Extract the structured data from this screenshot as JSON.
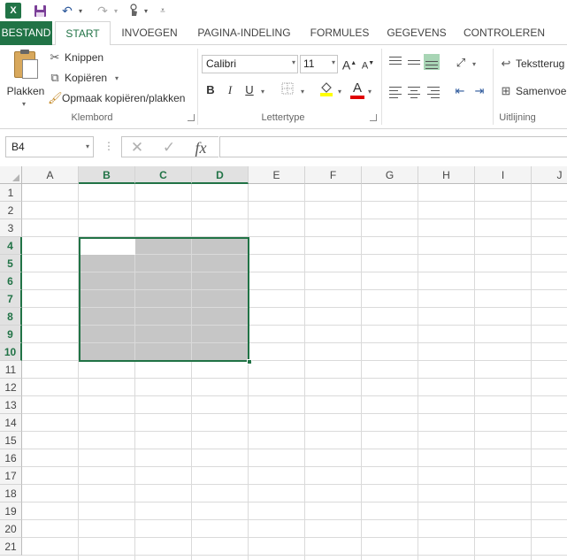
{
  "quick_access": {
    "app_icon": "excel-logo-icon",
    "app_icon_text": "X",
    "save_icon": "save-icon",
    "undo_icon": "undo-icon",
    "redo_icon": "redo-icon",
    "touch_icon": "touch-mode-icon",
    "customize_icon": "customize-toolbar-icon"
  },
  "tabs": [
    {
      "label": "BESTAND",
      "active": false
    },
    {
      "label": "START",
      "active": true
    },
    {
      "label": "INVOEGEN",
      "active": false
    },
    {
      "label": "PAGINA-INDELING",
      "active": false
    },
    {
      "label": "FORMULES",
      "active": false
    },
    {
      "label": "GEGEVENS",
      "active": false
    },
    {
      "label": "CONTROLEREN",
      "active": false
    }
  ],
  "ribbon": {
    "clipboard": {
      "paste_label": "Plakken",
      "cut_label": "Knippen",
      "copy_label": "Kopiëren",
      "format_painter_label": "Opmaak kopiëren/plakken",
      "group_label": "Klembord"
    },
    "font": {
      "font_name": "Calibri",
      "font_size": "11",
      "bold": "B",
      "italic": "I",
      "underline": "U",
      "font_color_letter": "A",
      "grow_font": "A",
      "shrink_font": "A",
      "group_label": "Lettertype"
    },
    "alignment": {
      "wrap_text_label": "Tekstterug",
      "merge_label": "Samenvoe",
      "group_label": "Uitlijning"
    }
  },
  "formula_bar": {
    "name_box": "B4",
    "dots": "⋮",
    "cancel_icon": "✕",
    "enter_icon": "✓",
    "fx_label": "fx",
    "formula_value": ""
  },
  "sheet": {
    "columns": [
      "A",
      "B",
      "C",
      "D",
      "E",
      "F",
      "G",
      "H",
      "I",
      "J"
    ],
    "selected_columns": [
      "B",
      "C",
      "D"
    ],
    "rows": [
      "1",
      "2",
      "3",
      "4",
      "5",
      "6",
      "7",
      "8",
      "9",
      "10",
      "11",
      "12",
      "13",
      "14",
      "15",
      "16",
      "17",
      "18",
      "19",
      "20",
      "21"
    ],
    "selected_rows": [
      "4",
      "5",
      "6",
      "7",
      "8",
      "9",
      "10"
    ],
    "active_cell": "B4",
    "selection_range": "B4:D10",
    "colors": {
      "accent": "#217346",
      "selection_fill": "#c6c6c6"
    }
  }
}
